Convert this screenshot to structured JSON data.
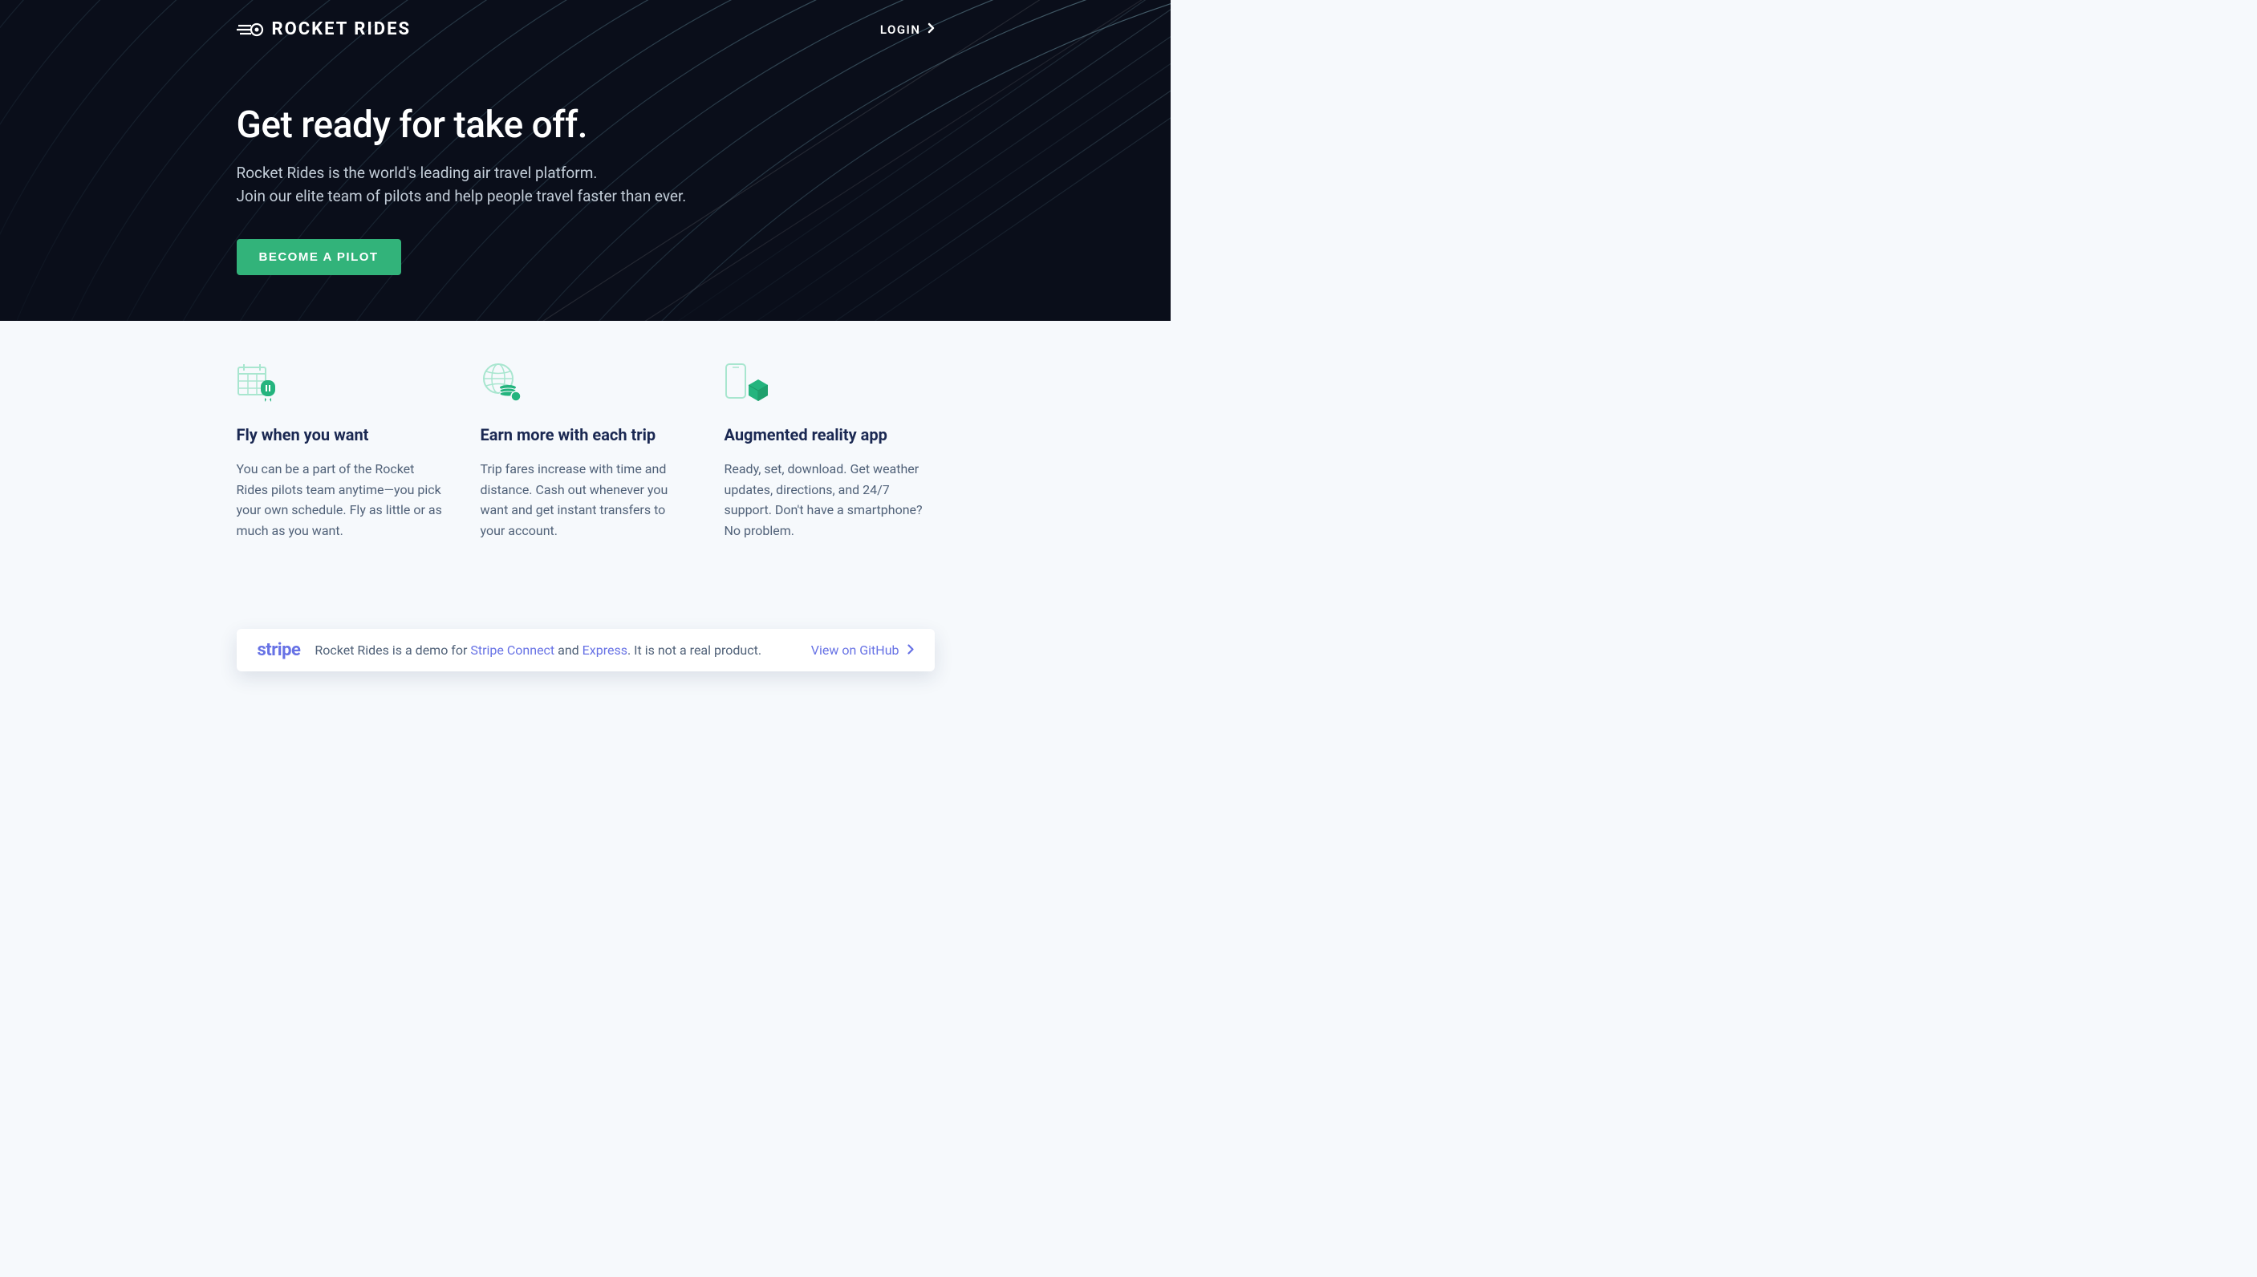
{
  "brand": {
    "name": "ROCKET RIDES"
  },
  "nav": {
    "login_label": "LOGIN"
  },
  "hero": {
    "headline": "Get ready for take off.",
    "subline1": "Rocket Rides is the world's leading air travel platform.",
    "subline2": "Join our elite team of pilots and help people travel faster than ever.",
    "cta_label": "BECOME A PILOT"
  },
  "features": [
    {
      "title": "Fly when you want",
      "body": "You can be a part of the Rocket Rides pilots team anytime—you pick your own schedule. Fly as little or as much as you want."
    },
    {
      "title": "Earn more with each trip",
      "body": "Trip fares increase with time and distance. Cash out whenever you want and get instant transfers to your account."
    },
    {
      "title": "Augmented reality app",
      "body": "Ready, set, download. Get weather updates, directions, and 24/7 support. Don't have a smartphone? No problem."
    }
  ],
  "banner": {
    "stripe": "stripe",
    "text_prefix": "Rocket Rides is a demo for ",
    "link1": "Stripe Connect",
    "text_mid": " and ",
    "link2": "Express",
    "text_suffix": ". It is not a real product.",
    "github_label": "View on GitHub"
  }
}
